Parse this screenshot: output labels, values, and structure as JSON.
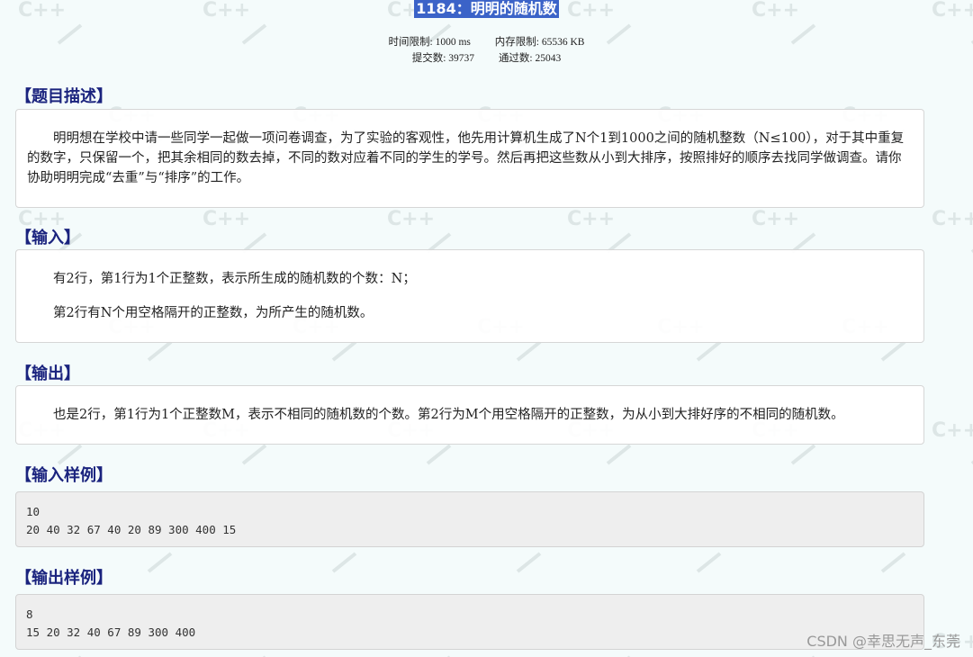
{
  "problem": {
    "title": "1184：明明的随机数",
    "time_limit": "时间限制: 1000 ms",
    "memory_limit": "内存限制: 65536 KB",
    "submissions": "提交数: 39737",
    "accepted": "通过数: 25043"
  },
  "sections": {
    "description": {
      "heading": "【题目描述】",
      "text": "明明想在学校中请一些同学一起做一项问卷调查，为了实验的客观性，他先用计算机生成了N个1到1000之间的随机整数（N≤100），对于其中重复的数字，只保留一个，把其余相同的数去掉，不同的数对应着不同的学生的学号。然后再把这些数从小到大排序，按照排好的顺序去找同学做调查。请你协助明明完成“去重”与“排序”的工作。"
    },
    "input": {
      "heading": "【输入】",
      "line1": "有2行，第1行为1个正整数，表示所生成的随机数的个数：N；",
      "line2": "第2行有N个用空格隔开的正整数，为所产生的随机数。"
    },
    "output": {
      "heading": "【输出】",
      "text": "也是2行，第1行为1个正整数M，表示不相同的随机数的个数。第2行为M个用空格隔开的正整数，为从小到大排好序的不相同的随机数。"
    },
    "sample_input": {
      "heading": "【输入样例】",
      "line1": "10",
      "line2": "20 40 32 67 40 20 89 300 400 15"
    },
    "sample_output": {
      "heading": "【输出样例】",
      "line1": "8",
      "line2": "15 20 32 40 67 89 300 400"
    }
  },
  "watermark": {
    "text": "CSDN @幸思无声_东莞",
    "pattern_text": "C++"
  }
}
